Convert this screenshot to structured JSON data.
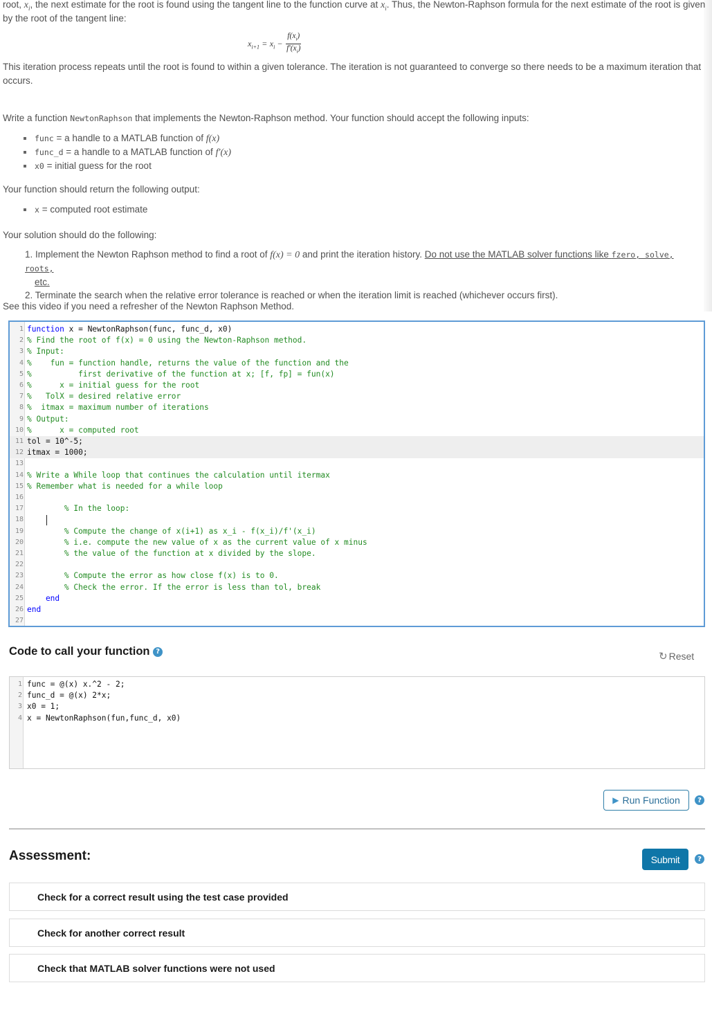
{
  "intro": {
    "line1_pre": "root, ",
    "line1_var": "x",
    "line1_sub": "i",
    "line1_mid": ", the next estimate for the root is found using the tangent line to the function curve at ",
    "line1_post": ". Thus, the Newton-Raphson formula for the next estimate of the root is given",
    "line2": "by the root of the tangent line:",
    "formula": {
      "lhs": "x",
      "lhs_sub": "i+1",
      "eq": "=",
      "x": "x",
      "x_sub": "i",
      "minus": "−",
      "numerator": "f(x",
      "denominator": "f'(x",
      "sub": "i",
      "close": ")"
    },
    "para2_line1": "This iteration process repeats until the root is found to within a given tolerance. The iteration is not guaranteed to converge so there needs to be a maximum iteration that",
    "para2_line2": "occurs."
  },
  "task": {
    "write_pre": "Write a function ",
    "write_code": "NewtonRaphson",
    "write_post": " that implements the Newton-Raphson method. Your function should accept the following inputs:",
    "inputs": [
      {
        "code": "func",
        "text": " = a handle to a MATLAB function of ",
        "math": "f(x)"
      },
      {
        "code": "func_d",
        "text": " = a handle to a MATLAB function of ",
        "math": "f'(x)"
      },
      {
        "code": "x0",
        "text": " = initial guess for the root",
        "math": ""
      }
    ],
    "return_label": "Your function should return the following output:",
    "outputs": [
      {
        "code": "x",
        "text": " = computed root estimate"
      }
    ],
    "solution_label": "Your solution should do the following:",
    "steps": [
      {
        "num": "1.",
        "pre": "Implement the Newton Raphson method to find a root of ",
        "math": "f(x) = 0",
        "mid": " and print the iteration history. ",
        "underlined": "Do not use the MATLAB solver functions like ",
        "code": "fzero, solve, roots,",
        "underlined_end": "etc."
      },
      {
        "num": "2.",
        "text": "Terminate the search when the relative error tolerance is reached or when the iteration limit is reached (whichever occurs first)."
      }
    ],
    "video_note": "See this video if you need a refresher of the Newton Raphson Method."
  },
  "function_editor": {
    "lines": [
      {
        "n": "1",
        "parts": [
          {
            "t": "kw",
            "s": "function"
          },
          {
            "t": "tx",
            "s": " x = NewtonRaphson(func, func_d, x0)"
          }
        ]
      },
      {
        "n": "2",
        "parts": [
          {
            "t": "cm",
            "s": "% Find the root of f(x) = 0 using the Newton-Raphson method."
          }
        ]
      },
      {
        "n": "3",
        "parts": [
          {
            "t": "cm",
            "s": "% Input:"
          }
        ]
      },
      {
        "n": "4",
        "parts": [
          {
            "t": "cm",
            "s": "%    fun = function handle, returns the value of the function and the"
          }
        ]
      },
      {
        "n": "5",
        "parts": [
          {
            "t": "cm",
            "s": "%          first derivative of the function at x; [f, fp] = fun(x)"
          }
        ]
      },
      {
        "n": "6",
        "parts": [
          {
            "t": "cm",
            "s": "%      x = initial guess for the root"
          }
        ]
      },
      {
        "n": "7",
        "parts": [
          {
            "t": "cm",
            "s": "%   TolX = desired relative error"
          }
        ]
      },
      {
        "n": "8",
        "parts": [
          {
            "t": "cm",
            "s": "%  itmax = maximum number of iterations"
          }
        ]
      },
      {
        "n": "9",
        "parts": [
          {
            "t": "cm",
            "s": "% Output:"
          }
        ]
      },
      {
        "n": "10",
        "parts": [
          {
            "t": "cm",
            "s": "%      x = computed root"
          }
        ]
      },
      {
        "n": "11",
        "hl": true,
        "parts": [
          {
            "t": "tx",
            "s": "tol = 10^-5;"
          }
        ]
      },
      {
        "n": "12",
        "hl": true,
        "parts": [
          {
            "t": "tx",
            "s": "itmax = 1000;"
          }
        ]
      },
      {
        "n": "13",
        "parts": []
      },
      {
        "n": "14",
        "parts": [
          {
            "t": "cm",
            "s": "% Write a While loop that continues the calculation until itermax"
          }
        ]
      },
      {
        "n": "15",
        "parts": [
          {
            "t": "cm",
            "s": "% Remember what is needed for a while loop"
          }
        ]
      },
      {
        "n": "16",
        "parts": []
      },
      {
        "n": "17",
        "parts": [
          {
            "t": "cm",
            "s": "        % In the loop:"
          }
        ]
      },
      {
        "n": "18",
        "parts": []
      },
      {
        "n": "19",
        "parts": [
          {
            "t": "cm",
            "s": "        % Compute the change of x(i+1) as x_i - f(x_i)/f'(x_i)"
          }
        ]
      },
      {
        "n": "20",
        "parts": [
          {
            "t": "cm",
            "s": "        % i.e. compute the new value of x as the current value of x minus"
          }
        ]
      },
      {
        "n": "21",
        "parts": [
          {
            "t": "cm",
            "s": "        % the value of the function at x divided by the slope."
          }
        ]
      },
      {
        "n": "22",
        "parts": []
      },
      {
        "n": "23",
        "parts": [
          {
            "t": "cm",
            "s": "        % Compute the error as how close f(x) is to 0."
          }
        ]
      },
      {
        "n": "24",
        "parts": [
          {
            "t": "cm",
            "s": "        % Check the error. If the error is less than tol, break"
          }
        ]
      },
      {
        "n": "25",
        "parts": [
          {
            "t": "kw",
            "s": "    end"
          }
        ]
      },
      {
        "n": "26",
        "parts": [
          {
            "t": "kw",
            "s": "end"
          }
        ]
      },
      {
        "n": "27",
        "parts": []
      }
    ]
  },
  "call_section": {
    "title": "Code to call your function",
    "help_icon": "?",
    "reset_label": "Reset",
    "reset_icon": "↻",
    "lines": [
      {
        "n": "1",
        "s": "func = @(x) x.^2 - 2;"
      },
      {
        "n": "2",
        "s": "func_d = @(x) 2*x;"
      },
      {
        "n": "3",
        "s": "x0 = 1;"
      },
      {
        "n": "4",
        "s": "x = NewtonRaphson(fun,func_d, x0)"
      }
    ],
    "run_label": "Run Function",
    "run_icon": "▶"
  },
  "assessment": {
    "title": "Assessment:",
    "submit_label": "Submit",
    "help_icon": "?",
    "items": [
      "Check for a correct result using the test case provided",
      "Check for another correct result",
      "Check that MATLAB solver functions were not used"
    ]
  },
  "colors": {
    "accent": "#0f76a8",
    "editor_border": "#5e9bd6",
    "keyword": "#0000ff",
    "comment": "#228b22"
  }
}
